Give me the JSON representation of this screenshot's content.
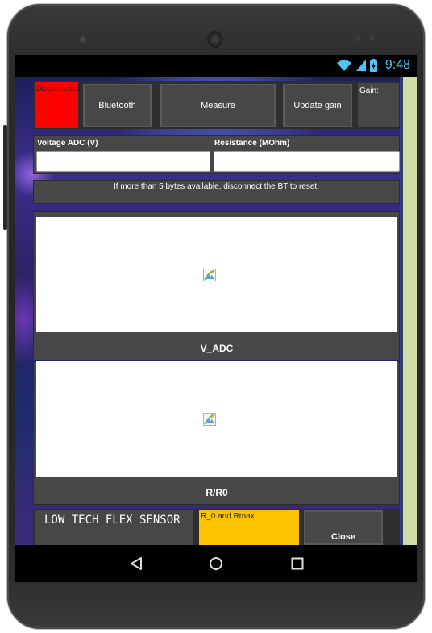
{
  "statusbar": {
    "time": "9:48",
    "icons": [
      "wifi-icon",
      "signal-icon",
      "battery-icon"
    ]
  },
  "topbar": {
    "connection_status": "Disconnected",
    "connection_color": "#ff0000",
    "bluetooth_label": "Bluetooth",
    "measure_label": "Measure",
    "update_gain_label": "Update gain",
    "gain_label": "Gain:"
  },
  "readings": {
    "voltage_label": "Voltage ADC (V)",
    "voltage_value": "",
    "resistance_label": "Resistance (MOhm)",
    "resistance_value": ""
  },
  "info": {
    "message": "If more than 5 bytes available, disconnect the BT to reset."
  },
  "plots": [
    {
      "caption": "V_ADC",
      "icon": "image-placeholder-icon"
    },
    {
      "caption": "R/R0",
      "icon": "image-placeholder-icon"
    }
  ],
  "footer": {
    "title": "LOW TECH FLEX SENSOR",
    "r_box_label": "R_0 and Rmax",
    "r_box_color": "#ffc400",
    "close_label": "Close"
  },
  "navbar": {
    "icons": [
      "back-icon",
      "home-icon",
      "recents-icon"
    ]
  }
}
